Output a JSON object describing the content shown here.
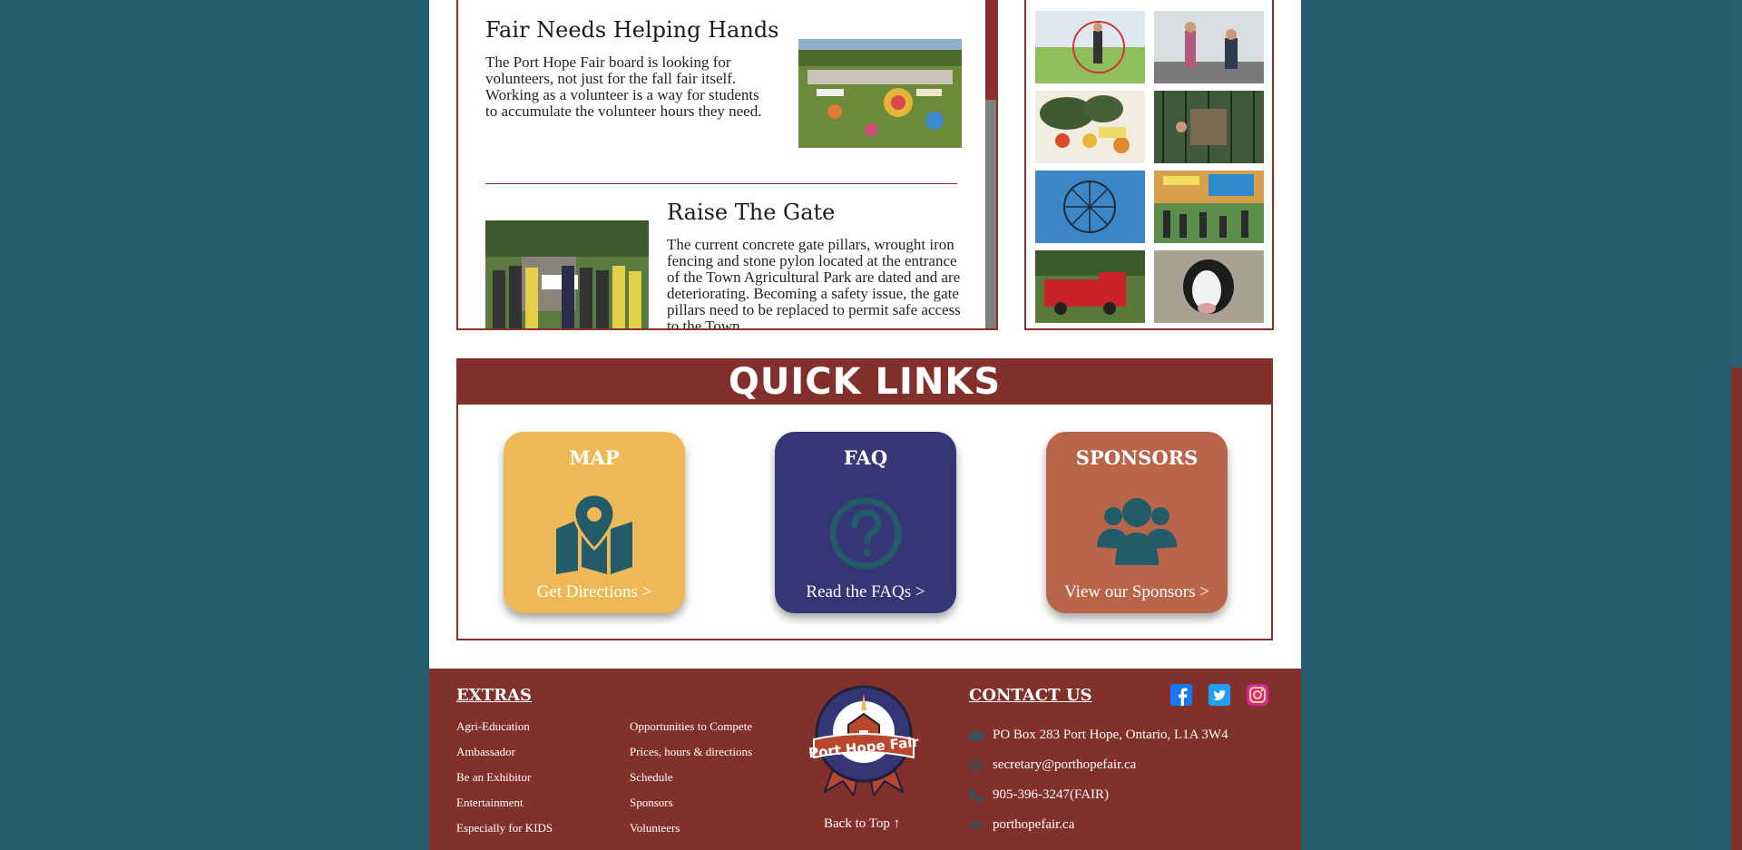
{
  "articles": [
    {
      "title": "Fair Needs Helping Hands",
      "body": "The Port Hope Fair board is looking for volunteers, not just for the fall fair itself. Working as a volunteer is a way for students to accumulate the volunteer hours they need."
    },
    {
      "title": "Raise The Gate",
      "body": "The current concrete gate pillars, wrought iron fencing and stone pylon located at the entrance of the Town Agricultural Park are dated and are deteriorating. Becoming a safety issue, the gate pillars need to be replaced to permit safe access to the Town"
    }
  ],
  "quick_links": {
    "heading": "QUICK LINKS",
    "cards": [
      {
        "title": "MAP",
        "link": "Get Directions >",
        "icon": "map-pin-icon",
        "color": "#edb957"
      },
      {
        "title": "FAQ",
        "link": "Read the FAQs >",
        "icon": "question-circle-icon",
        "color": "#353675"
      },
      {
        "title": "SPONSORS",
        "link": "View our Sponsors >",
        "icon": "users-group-icon",
        "color": "#b9654a"
      }
    ]
  },
  "footer": {
    "extras_heading": "EXTRAS",
    "extras_col1": [
      "Agri-Education",
      "Ambassador",
      "Be an Exhibitor",
      "Entertainment",
      "Especially for KIDS"
    ],
    "extras_col2": [
      "Opportunities to Compete",
      "Prices, hours & directions",
      "Schedule",
      "Sponsors",
      "Volunteers"
    ],
    "logo_text": "Port Hope Fair",
    "back_to_top": "Back to Top ↑",
    "contact_heading": "CONTACT US",
    "contact": [
      {
        "icon": "envelope-icon",
        "text": "PO Box 283 Port Hope, Ontario, L1A 3W4"
      },
      {
        "icon": "at-icon",
        "text": "secretary@porthopefair.ca"
      },
      {
        "icon": "phone-icon",
        "text": "905-396-3247(FAIR)"
      },
      {
        "icon": "link-icon",
        "text": "porthopefair.ca"
      }
    ],
    "social": [
      "facebook-icon",
      "twitter-icon",
      "instagram-icon"
    ]
  },
  "colors": {
    "background": "#255d6c",
    "maroon": "#82302b",
    "map_card": "#edb957",
    "faq_card": "#353675",
    "sponsor_card": "#b9654a",
    "icon_teal": "#235b69"
  }
}
